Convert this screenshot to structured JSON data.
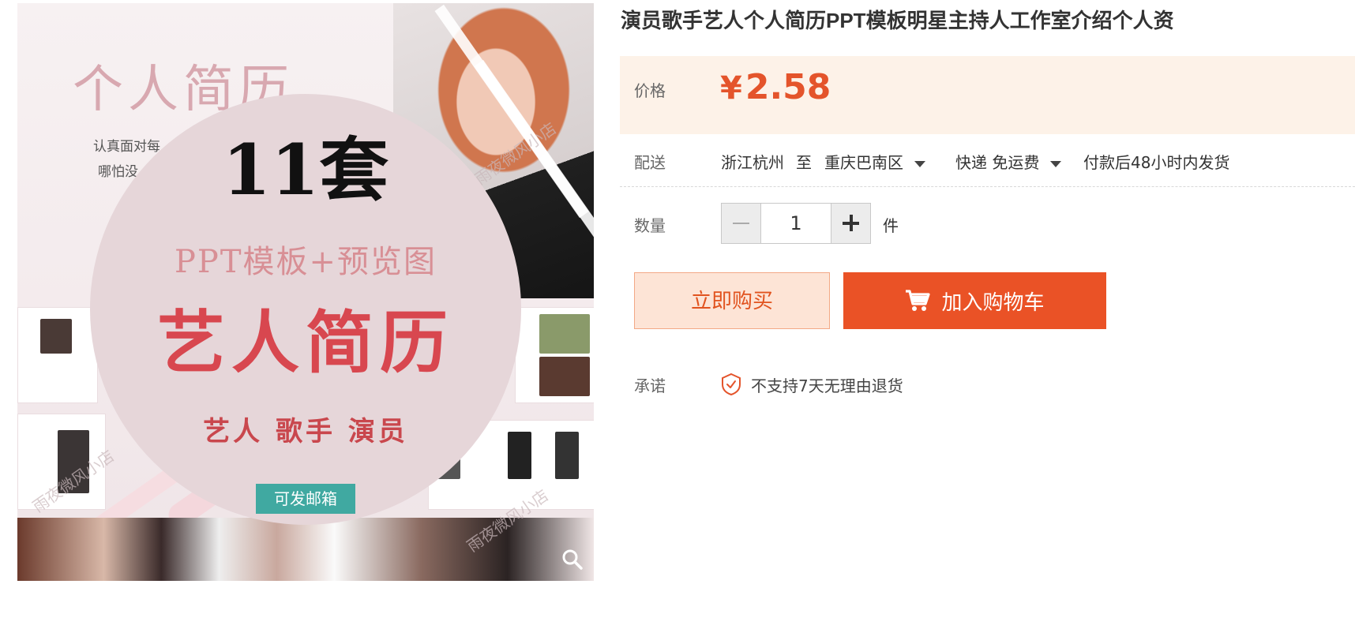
{
  "product": {
    "title": "演员歌手艺人个人简历PPT模板明星主持人工作室介绍个人资"
  },
  "image": {
    "bg_title": "个人简历",
    "bg_sub_1": "认真面对每",
    "bg_sub_2": "哪怕没",
    "count": "11套",
    "subtitle": "PPT模板+预览图",
    "main_title": "艺人简历",
    "tags": "艺人 歌手 演员",
    "badge": "可发邮箱",
    "watermark": "雨夜微风小店"
  },
  "price": {
    "label": "价格",
    "currency": "¥",
    "value": "2.58"
  },
  "delivery": {
    "label": "配送",
    "from": "浙江杭州",
    "to_word": "至",
    "destination": "重庆巴南区",
    "shipping": "快递 免运费",
    "ship_time": "付款后48小时内发货"
  },
  "quantity": {
    "label": "数量",
    "value": "1",
    "unit": "件"
  },
  "actions": {
    "buy_now": "立即购买",
    "add_to_cart": "加入购物车"
  },
  "promise": {
    "label": "承诺",
    "text": "不支持7天无理由退货"
  },
  "colors": {
    "accent": "#ea5226",
    "price_bg": "#fdf2e8",
    "badge": "#40a9a1"
  }
}
